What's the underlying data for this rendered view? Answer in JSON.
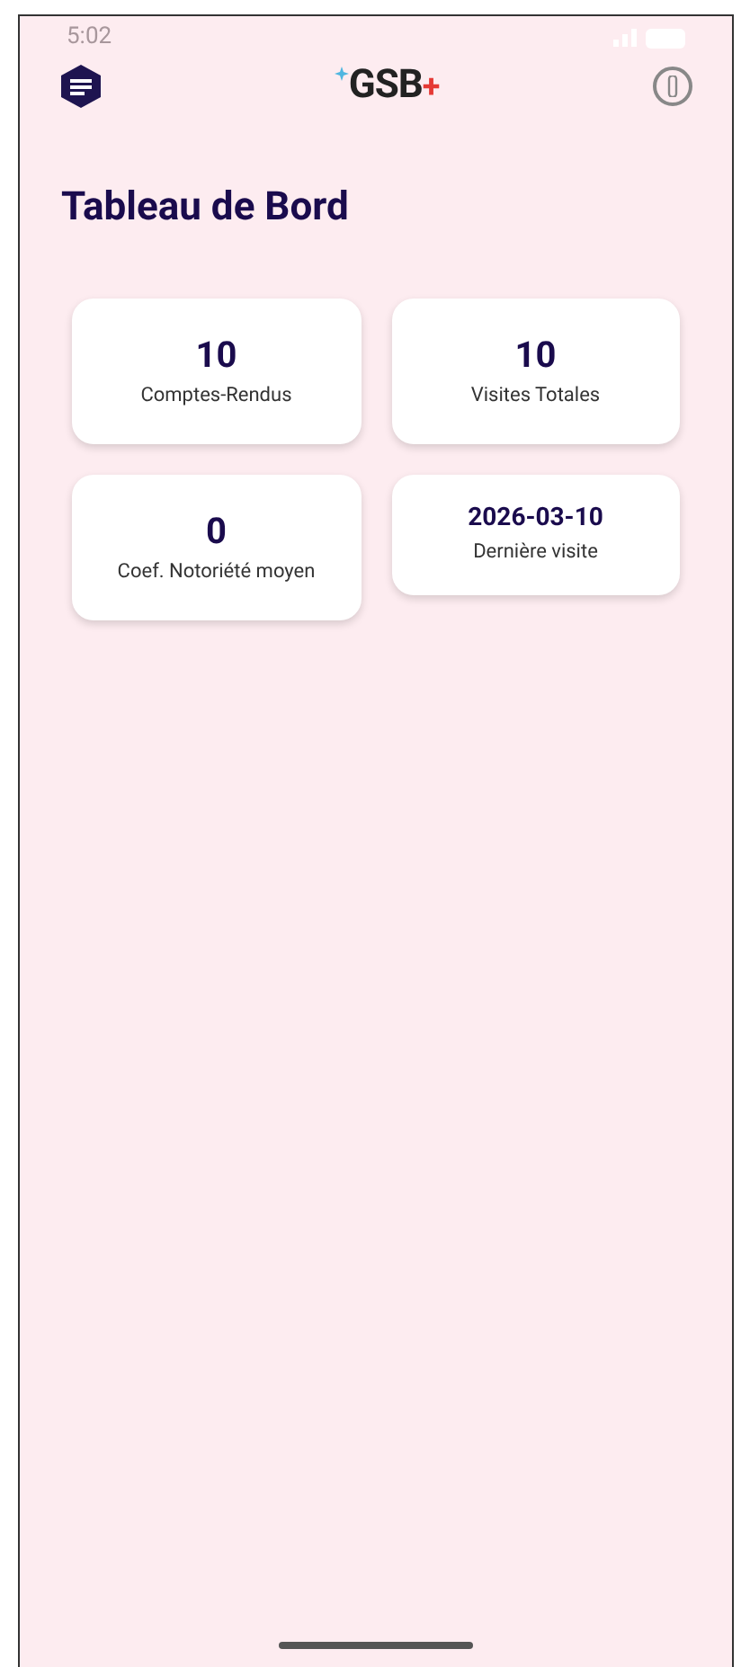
{
  "status_bar": {
    "time": "5:02"
  },
  "header": {
    "logo": {
      "text": "GSB",
      "mark": "+"
    }
  },
  "title": "Tableau de Bord",
  "stats": [
    {
      "value": "10",
      "label": "Comptes-Rendus",
      "kind": "big"
    },
    {
      "value": "10",
      "label": "Visites Totales",
      "kind": "big"
    },
    {
      "value": "0",
      "label": "Coef. Notoriété moyen",
      "kind": "big"
    },
    {
      "value": "2026-03-10",
      "label": "Dernière visite",
      "kind": "date"
    }
  ]
}
